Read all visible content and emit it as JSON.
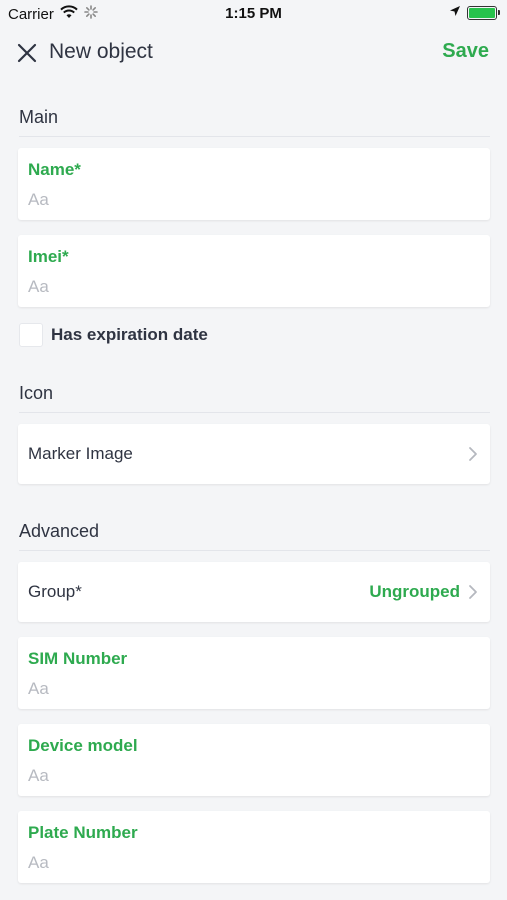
{
  "status_bar": {
    "carrier": "Carrier",
    "time": "1:15 PM"
  },
  "nav": {
    "title": "New object",
    "save_label": "Save"
  },
  "sections": {
    "main": "Main",
    "icon": "Icon",
    "advanced": "Advanced"
  },
  "fields": {
    "name": {
      "label": "Name*",
      "placeholder": "Aa"
    },
    "imei": {
      "label": "Imei*",
      "placeholder": "Aa"
    },
    "sim": {
      "label": "SIM Number",
      "placeholder": "Aa"
    },
    "device_model": {
      "label": "Device model",
      "placeholder": "Aa"
    },
    "plate": {
      "label": "Plate Number",
      "placeholder": "Aa"
    }
  },
  "expiration": {
    "label": "Has expiration date",
    "checked": false
  },
  "marker_image": {
    "label": "Marker Image"
  },
  "group": {
    "label": "Group*",
    "value": "Ungrouped"
  },
  "colors": {
    "accent": "#2eaa4f",
    "background": "#f4f5f7",
    "text": "#2f3442",
    "placeholder": "#b7bac1"
  },
  "icons": [
    "wifi-icon",
    "activity-spinner-icon",
    "location-arrow-icon",
    "battery-icon",
    "close-icon",
    "chevron-right-icon"
  ]
}
